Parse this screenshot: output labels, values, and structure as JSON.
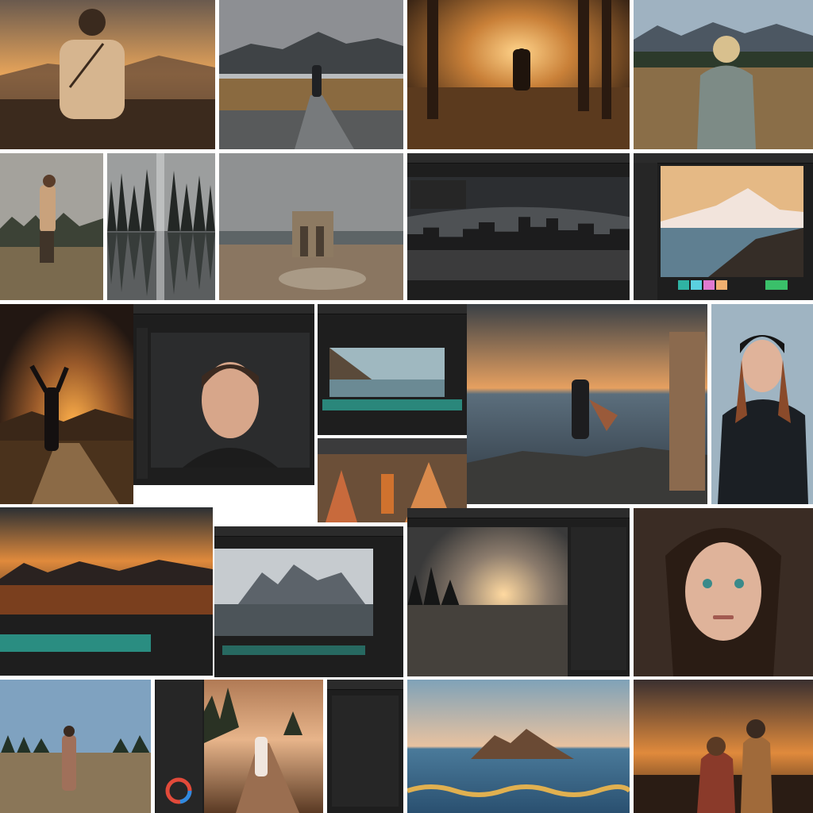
{
  "collage": {
    "background": "#ffffff",
    "palette": {
      "sunset": "#e08a3c",
      "teal": "#2fb3a3",
      "editor": "#1e1e1e"
    },
    "tiles": [
      "man-sunset-back-view",
      "lone-walker-lake-mountains",
      "woman-forest-sunset-silhouette",
      "woman-hoodie-meadow-mountains",
      "woman-misty-field",
      "forest-lake-reflection",
      "stone-ruin-beach",
      "city-skyline-editor",
      "snow-mountain-editor",
      "arms-raised-sunset-road",
      "portrait-editor-young-man",
      "video-editor-coast-workspace",
      "rocky-shore-sunset",
      "woman-beanie-portrait",
      "mountain-lake-sunset-timeline",
      "mountain-fjord-editor",
      "lake-sunset-editor",
      "woman-portrait-green-eyes",
      "man-field-blue-sky",
      "editor-panel-color-wheel",
      "woman-dirt-road",
      "editor-layers-panel",
      "island-rock-sea-waveform",
      "couple-sunset"
    ]
  }
}
